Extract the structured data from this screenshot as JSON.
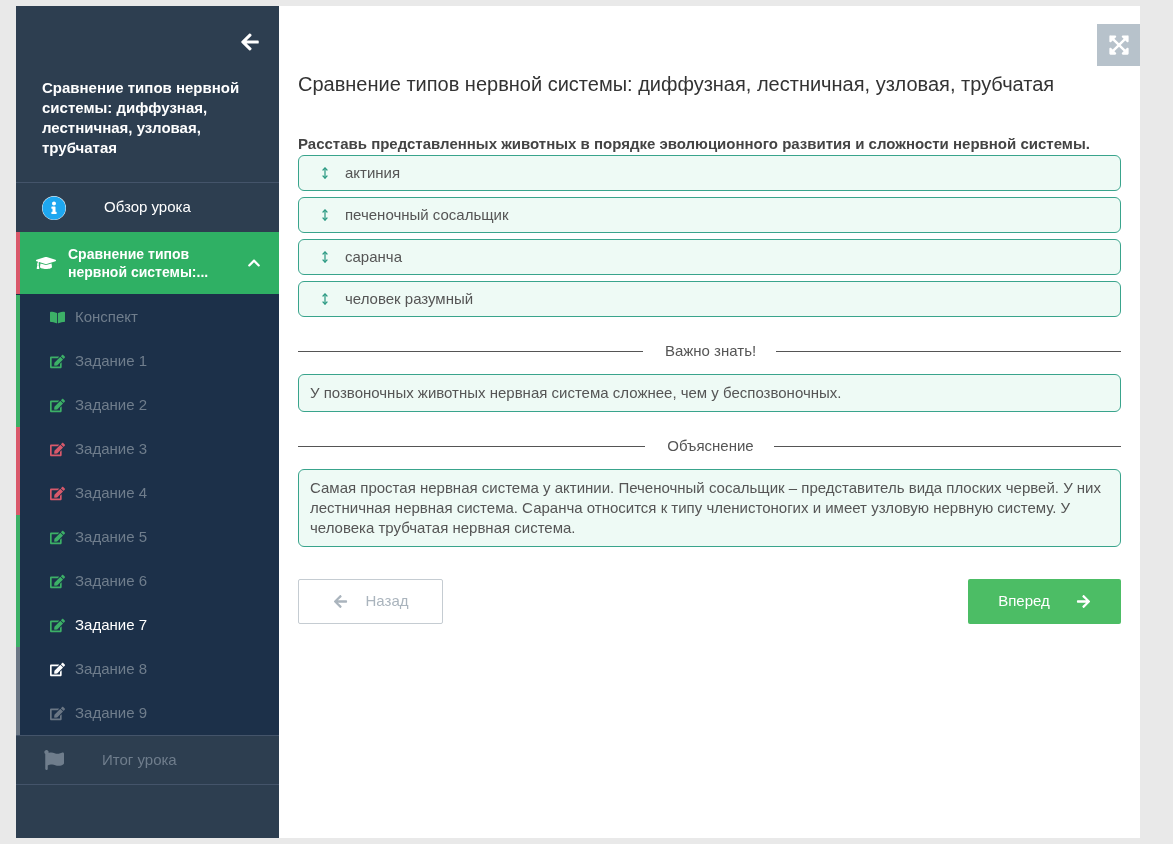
{
  "sidebar": {
    "lesson_title": "Сравнение типов нервной системы: диффузная, лестничная, узловая, трубчатая",
    "overview": {
      "label": "Обзор урока"
    },
    "section": {
      "label": "Сравнение типов нервной системы:...",
      "expanded": true
    },
    "items": [
      {
        "kind": "notes",
        "label": "Конспект",
        "color": "#3cb067",
        "highlighted": false,
        "selected": false
      },
      {
        "kind": "task",
        "label": "Задание 1",
        "color": "#3cb067",
        "highlighted": false,
        "selected": false
      },
      {
        "kind": "task",
        "label": "Задание 2",
        "color": "#3cb067",
        "highlighted": false,
        "selected": false
      },
      {
        "kind": "task",
        "label": "Задание 3",
        "color": "#d9596b",
        "highlighted": false,
        "selected": false
      },
      {
        "kind": "task",
        "label": "Задание 4",
        "color": "#d9596b",
        "highlighted": false,
        "selected": false
      },
      {
        "kind": "task",
        "label": "Задание 5",
        "color": "#3cb067",
        "highlighted": false,
        "selected": false
      },
      {
        "kind": "task",
        "label": "Задание 6",
        "color": "#3cb067",
        "highlighted": false,
        "selected": false
      },
      {
        "kind": "task",
        "label": "Задание 7",
        "color": "#3cb067",
        "highlighted": false,
        "selected": true
      },
      {
        "kind": "task",
        "label": "Задание 8",
        "color": "#6b7785",
        "highlighted": true,
        "selected": false
      },
      {
        "kind": "task",
        "label": "Задание 9",
        "color": "#6b7785",
        "highlighted": false,
        "selected": false
      }
    ],
    "summary": {
      "label": "Итог урока",
      "disabled": true
    }
  },
  "main": {
    "title": "Сравнение типов нервной системы: диффузная, лестничная, узловая, трубчатая",
    "question": "Расставь представленных животных в порядке эволюционного развития и сложности нервной системы.",
    "answers": [
      "актиния",
      "печеночный сосальщик",
      "саранча",
      "человек разумный"
    ],
    "notes": [
      {
        "heading": "Важно знать!",
        "text": "У позвоночных животных нервная система сложнее, чем у беспозвоночных."
      },
      {
        "heading": "Объяснение",
        "text": "Самая простая нервная система у актинии. Печеночный сосальщик – представитель вида плоских червей. У них лестничная нервная система. Саранча относится к типу членистоногих и имеет узловую нервную систему. У человека трубчатая нервная система."
      }
    ],
    "back_button": {
      "label": "Назад",
      "disabled": true
    },
    "next_button": {
      "label": "Вперед",
      "disabled": false
    }
  }
}
